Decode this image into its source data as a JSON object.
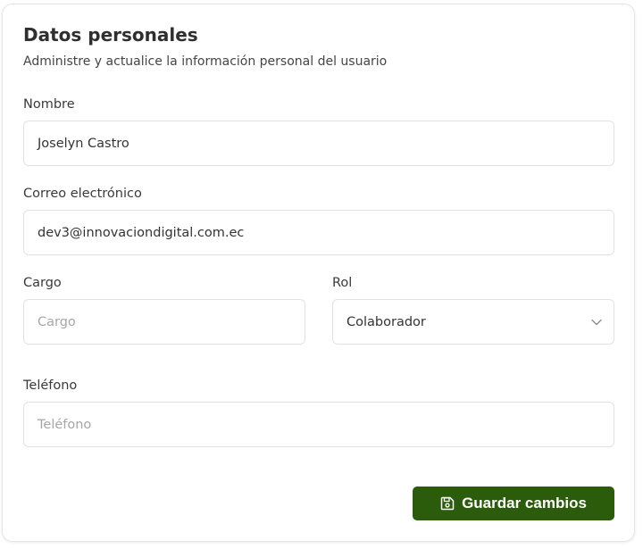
{
  "section": {
    "title": "Datos personales",
    "subtitle": "Administre y actualice la información personal del usuario"
  },
  "fields": {
    "nombre": {
      "label": "Nombre",
      "value": "Joselyn Castro"
    },
    "correo": {
      "label": "Correo electrónico",
      "value": "dev3@innovaciondigital.com.ec"
    },
    "cargo": {
      "label": "Cargo",
      "placeholder": "Cargo"
    },
    "rol": {
      "label": "Rol",
      "value": "Colaborador"
    },
    "telefono": {
      "label": "Teléfono",
      "placeholder": "Teléfono"
    }
  },
  "actions": {
    "save_label": "Guardar cambios",
    "save_icon": "floppy-disk-icon"
  },
  "colors": {
    "accent": "#2b5c0b",
    "border": "#e2e2e2",
    "placeholder": "#a6a6a6"
  }
}
